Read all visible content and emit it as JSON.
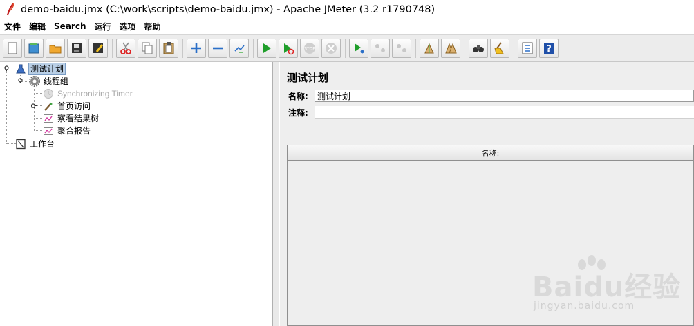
{
  "window": {
    "title": "demo-baidu.jmx (C:\\work\\scripts\\demo-baidu.jmx) - Apache JMeter (3.2 r1790748)"
  },
  "menu": {
    "items": [
      "文件",
      "编辑",
      "Search",
      "运行",
      "选项",
      "帮助"
    ]
  },
  "toolbar": {
    "buttons": [
      "new-icon",
      "templates-icon",
      "open-icon",
      "save-icon",
      "save-as-icon",
      "cut-icon",
      "copy-icon",
      "paste-icon",
      "expand-icon",
      "collapse-icon",
      "toggle-icon",
      "start-icon",
      "start-no-pause-icon",
      "stop-icon",
      "shutdown-icon",
      "remote-start-icon",
      "remote-stop-icon",
      "remote-shutdown-icon",
      "clear-icon",
      "clear-all-icon",
      "search-icon",
      "reset-search-icon",
      "function-helper-icon",
      "help-icon"
    ]
  },
  "tree": {
    "items": [
      {
        "label": "测试计划",
        "icon": "test-plan-icon",
        "selected": true
      },
      {
        "label": "线程组",
        "icon": "thread-group-icon"
      },
      {
        "label": "Synchronizing Timer",
        "icon": "timer-icon",
        "disabled": true
      },
      {
        "label": "首页访问",
        "icon": "sampler-icon"
      },
      {
        "label": "察看结果树",
        "icon": "listener-icon"
      },
      {
        "label": "聚合报告",
        "icon": "listener-icon"
      },
      {
        "label": "工作台",
        "icon": "workbench-icon"
      }
    ]
  },
  "panel": {
    "title": "测试计划",
    "name_label": "名称:",
    "name_value": "测试计划",
    "comment_label": "注释:",
    "comment_value": "",
    "table_header": "名称:"
  },
  "watermark": {
    "text": "Baidu经验",
    "sub": "jingyan.baidu.com"
  },
  "colors": {
    "selection": "#b9cfe6",
    "play_green": "#1e9e2a",
    "help_blue": "#1f4fa8"
  }
}
